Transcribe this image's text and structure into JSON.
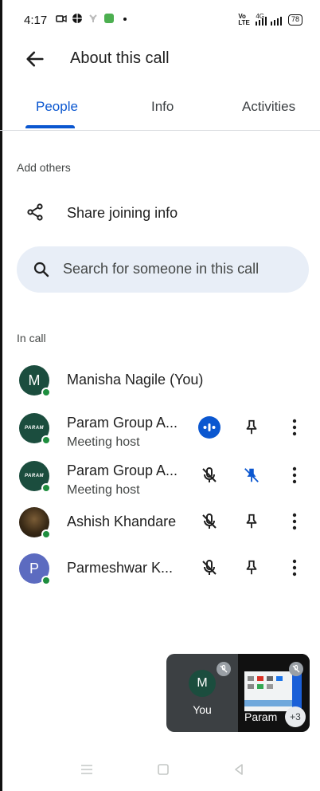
{
  "status_bar": {
    "time": "4:17",
    "network_label": "Vo LTE",
    "net_type": "4G",
    "battery": "78"
  },
  "header": {
    "title": "About this call"
  },
  "tabs": [
    {
      "label": "People",
      "active": true
    },
    {
      "label": "Info",
      "active": false
    },
    {
      "label": "Activities",
      "active": false
    }
  ],
  "add_others": {
    "label": "Add others",
    "share_label": "Share joining info"
  },
  "search": {
    "placeholder": "Search for someone in this call"
  },
  "in_call": {
    "label": "In call",
    "participants": [
      {
        "name": "Manisha Nagile (You)",
        "subtitle": "",
        "avatar": "M",
        "avatar_color": "#1b4d3e",
        "mic": "none",
        "pin": "none"
      },
      {
        "name": "Param Group A...",
        "subtitle": "Meeting host",
        "avatar": "PARAM",
        "avatar_color": "#1b4d3e",
        "mic": "speaking",
        "pin": "pin"
      },
      {
        "name": "Param Group A...",
        "subtitle": "Meeting host",
        "avatar": "PARAM",
        "avatar_color": "#1b4d3e",
        "mic": "muted",
        "pin": "pinned"
      },
      {
        "name": "Ashish Khandare",
        "subtitle": "",
        "avatar": "photo",
        "avatar_color": "#4a3a22",
        "mic": "muted",
        "pin": "pin"
      },
      {
        "name": "Parmeshwar K...",
        "subtitle": "",
        "avatar": "P",
        "avatar_color": "#5c6bc0",
        "mic": "muted",
        "pin": "pin"
      }
    ]
  },
  "preview": {
    "self_initial": "M",
    "self_label": "You",
    "screen_label": "Param",
    "more_count": "+3"
  },
  "colors": {
    "accent": "#0b57d0",
    "online": "#1e8e3e"
  }
}
